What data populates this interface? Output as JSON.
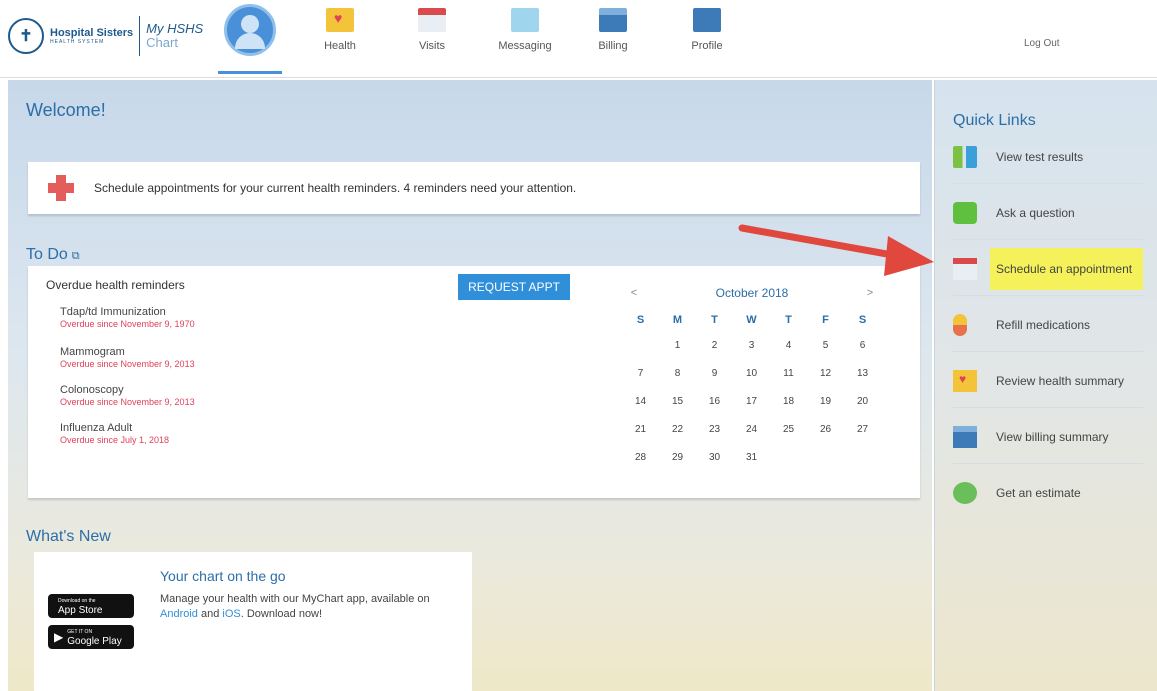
{
  "header": {
    "org_name": "Hospital Sisters",
    "org_sub": "HEALTH SYSTEM",
    "app_line1": "My HSHS",
    "app_line2": "Chart",
    "nav": [
      {
        "label": "Health",
        "icon": "heart-folder-icon"
      },
      {
        "label": "Visits",
        "icon": "calendar-icon"
      },
      {
        "label": "Messaging",
        "icon": "envelope-icon"
      },
      {
        "label": "Billing",
        "icon": "credit-card-icon"
      },
      {
        "label": "Profile",
        "icon": "id-card-icon"
      }
    ],
    "logout": "Log Out"
  },
  "main": {
    "welcome": "Welcome!",
    "alert_text": "Schedule appointments for your current health reminders. 4 reminders need your attention.",
    "todo": {
      "title": "To Do",
      "heading": "Overdue health reminders",
      "request_button": "REQUEST APPT",
      "reminders": [
        {
          "name": "Tdap/td Immunization",
          "due": "Overdue since November 9, 1970"
        },
        {
          "name": "Mammogram",
          "due": "Overdue since November 9, 2013"
        },
        {
          "name": "Colonoscopy",
          "due": "Overdue since November 9, 2013"
        },
        {
          "name": "Influenza Adult",
          "due": "Overdue since July 1, 2018"
        }
      ],
      "calendar": {
        "prev": "<",
        "next": ">",
        "month": "October 2018",
        "dow": [
          "S",
          "M",
          "T",
          "W",
          "T",
          "F",
          "S"
        ],
        "days": [
          "",
          "1",
          "2",
          "3",
          "4",
          "5",
          "6",
          "7",
          "8",
          "9",
          "10",
          "11",
          "12",
          "13",
          "14",
          "15",
          "16",
          "17",
          "18",
          "19",
          "20",
          "21",
          "22",
          "23",
          "24",
          "25",
          "26",
          "27",
          "28",
          "29",
          "30",
          "31",
          "",
          "",
          ""
        ]
      }
    },
    "whats_new": {
      "title": "What's New",
      "card_title": "Your chart on the go",
      "card_text_1": "Manage your health with our MyChart app, available on ",
      "link_android": "Android",
      "card_text_2": " and ",
      "link_ios": "iOS",
      "card_text_3": ". Download now!",
      "appstore_small": "Download on the",
      "appstore_big": "App Store",
      "googleplay_small": "GET IT ON",
      "googleplay_big": "Google Play"
    }
  },
  "quick_links": {
    "title": "Quick Links",
    "items": [
      {
        "label": "View test results",
        "icon": "test-tubes-icon"
      },
      {
        "label": "Ask a question",
        "icon": "chat-bubble-icon"
      },
      {
        "label": "Schedule an appointment",
        "icon": "calendar-icon",
        "highlighted": true
      },
      {
        "label": "Refill medications",
        "icon": "pill-icon"
      },
      {
        "label": "Review health summary",
        "icon": "heart-folder-icon"
      },
      {
        "label": "View billing summary",
        "icon": "credit-card-icon"
      },
      {
        "label": "Get an estimate",
        "icon": "estimate-icon"
      }
    ]
  },
  "colors": {
    "brand_blue": "#2b6ea8",
    "button_blue": "#2f8fd8",
    "overdue_red": "#e0415a",
    "highlight_yellow": "#f4f15a",
    "arrow_red": "#e0483e"
  }
}
